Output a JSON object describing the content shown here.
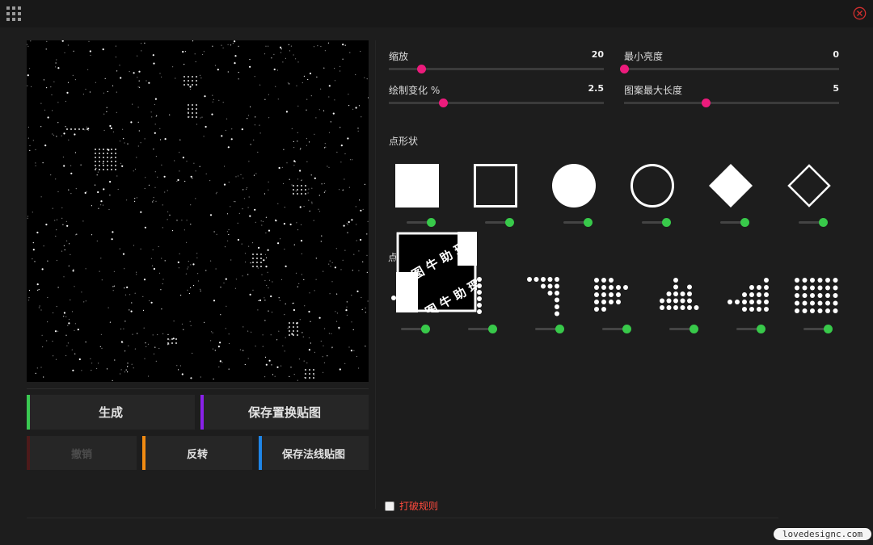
{
  "header": {
    "menu_icon": "grid-menu-icon",
    "close_icon": "close-circle-icon",
    "close_color": "#d32f2f"
  },
  "canvas": {
    "icon": "halftone-dot-preview",
    "background": "#000000"
  },
  "buttons": {
    "generate": {
      "label": "生成",
      "accent": "#3ac952"
    },
    "save_displacement": {
      "label": "保存置换贴图",
      "accent": "#8a21ea"
    },
    "undo": {
      "label": "撤销",
      "accent": "#5a1d1d"
    },
    "invert": {
      "label": "反转",
      "accent": "#f08a12"
    },
    "save_normal": {
      "label": "保存法线贴图",
      "accent": "#1f86e8"
    }
  },
  "sliders": [
    {
      "label": "缩放",
      "value": "20",
      "fill": 0.15
    },
    {
      "label": "最小亮度",
      "value": "0",
      "fill": 0.0
    },
    {
      "label": "绘制变化 %",
      "value": "2.5",
      "fill": 0.25
    },
    {
      "label": "图案最大长度",
      "value": "5",
      "fill": 0.38
    }
  ],
  "slider_accent": "#ec1b7c",
  "dot_shape": {
    "title": "点形状",
    "shapes": [
      "filled-square-icon",
      "outline-square-icon",
      "filled-circle-icon",
      "outline-circle-icon",
      "filled-diamond-icon",
      "outline-diamond-icon"
    ]
  },
  "dot_pattern": {
    "title": "点",
    "patterns": [
      "dot-pattern-1",
      "dot-pattern-2",
      "dot-pattern-3",
      "dot-pattern-4",
      "dot-pattern-5",
      "dot-pattern-6",
      "dot-pattern-7"
    ]
  },
  "toggle_color": "#38c94a",
  "watermark": {
    "line1": "图 牛 助 理",
    "line2": "图 牛 助 理"
  },
  "option": {
    "label": "打破规则",
    "checked": false
  },
  "site_badge": "lovedesignc.com"
}
